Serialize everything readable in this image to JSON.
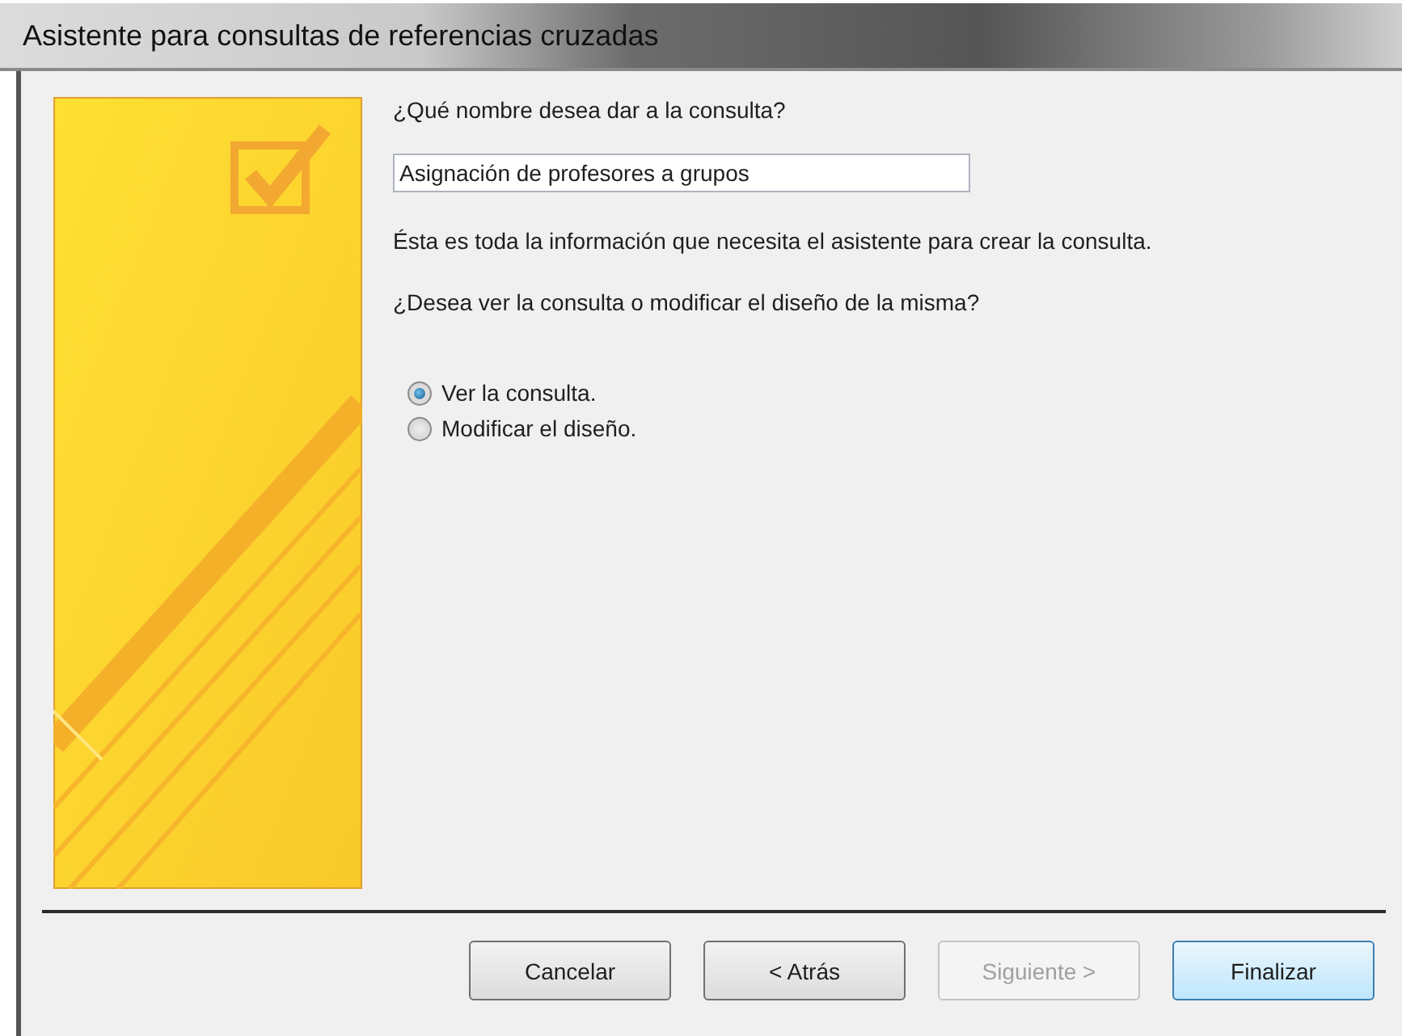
{
  "window": {
    "title": "Asistente para consultas de referencias cruzadas"
  },
  "name_prompt": "¿Qué nombre desea dar a la consulta?",
  "name_field": {
    "value": "Asignación de profesores a grupos"
  },
  "info_text": "Ésta es toda la información que necesita el asistente para crear la consulta.",
  "question": "¿Desea ver la consulta o modificar el diseño de la misma?",
  "options": [
    {
      "label": "Ver la consulta.",
      "selected": true
    },
    {
      "label": "Modificar el diseño.",
      "selected": false
    }
  ],
  "buttons": [
    {
      "label": "Cancelar",
      "disabled": false,
      "default": false
    },
    {
      "label": "< Atrás",
      "disabled": false,
      "default": false
    },
    {
      "label": "Siguiente >",
      "disabled": true,
      "default": false
    },
    {
      "label": "Finalizar",
      "disabled": false,
      "default": true
    }
  ]
}
